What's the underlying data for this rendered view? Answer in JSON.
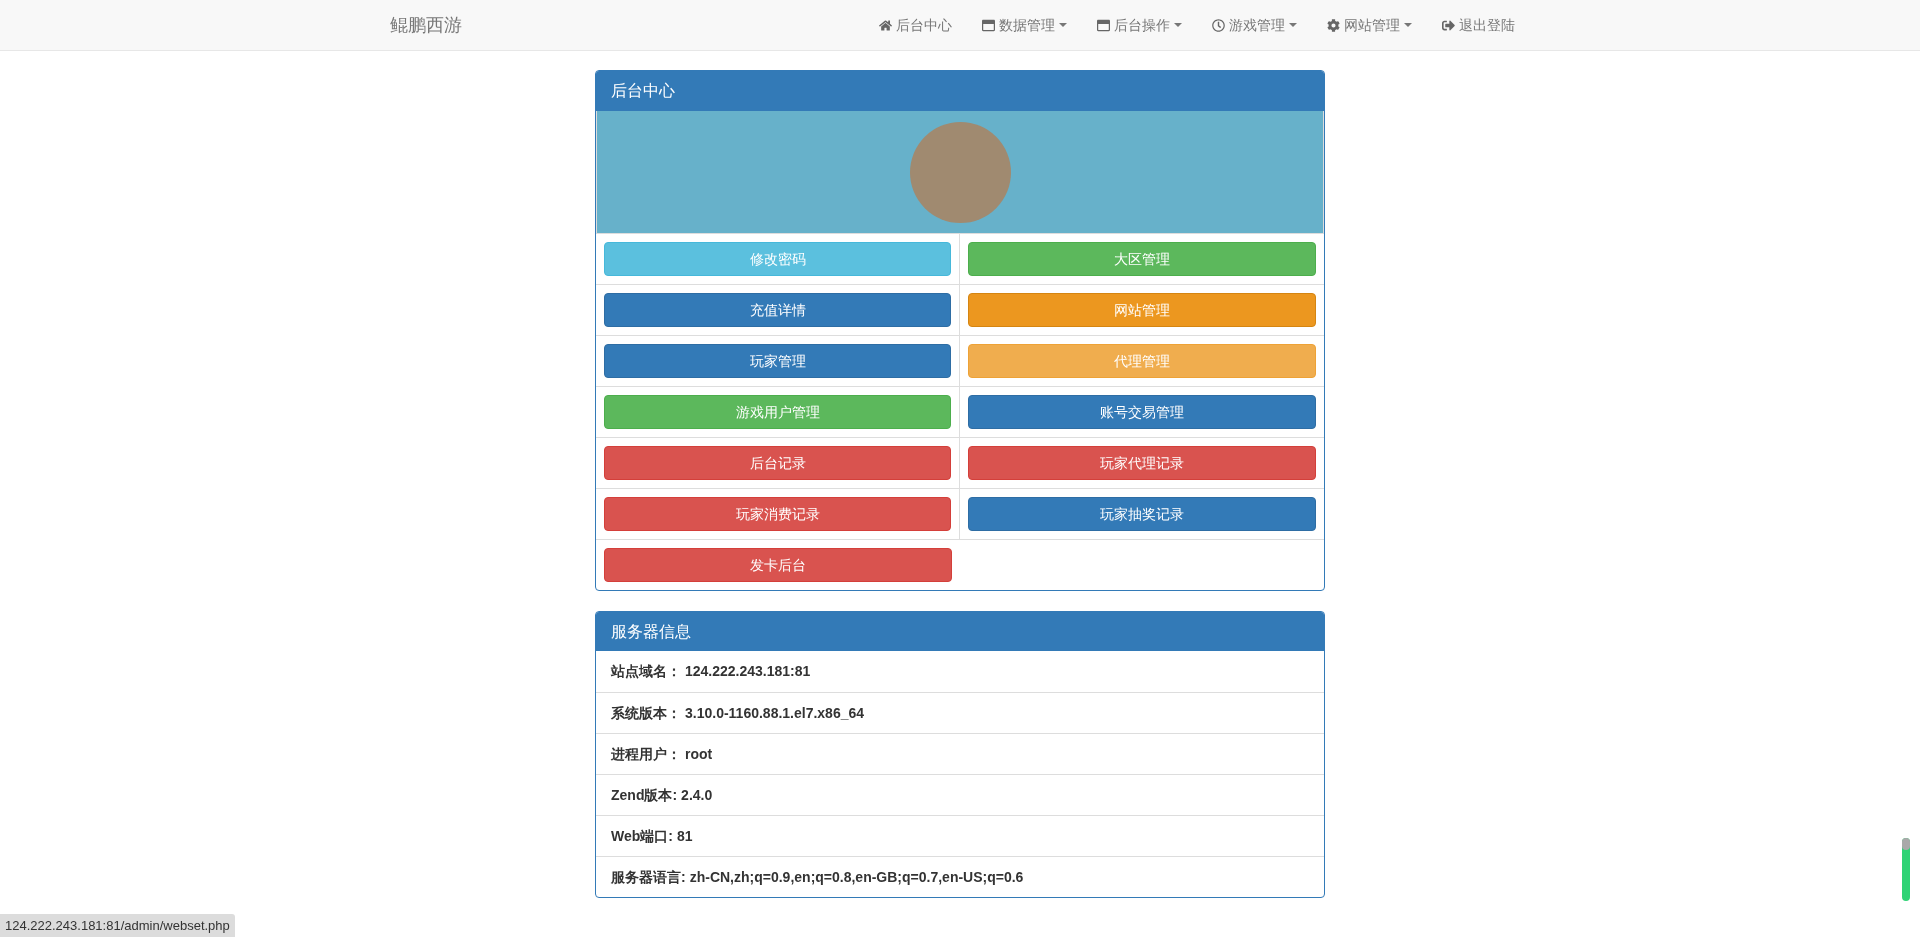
{
  "navbar": {
    "brand": "鲲鹏西游",
    "items": [
      {
        "label": "后台中心",
        "dropdown": false
      },
      {
        "label": "数据管理",
        "dropdown": true
      },
      {
        "label": "后台操作",
        "dropdown": true
      },
      {
        "label": "游戏管理",
        "dropdown": true
      },
      {
        "label": "网站管理",
        "dropdown": true
      },
      {
        "label": "退出登陆",
        "dropdown": false
      }
    ]
  },
  "admin_panel": {
    "title": "后台中心",
    "buttons": [
      {
        "label": "修改密码",
        "kind": "info"
      },
      {
        "label": "大区管理",
        "kind": "success"
      },
      {
        "label": "充值详情",
        "kind": "primary"
      },
      {
        "label": "网站管理",
        "kind": "orange"
      },
      {
        "label": "玩家管理",
        "kind": "primary"
      },
      {
        "label": "代理管理",
        "kind": "warning"
      },
      {
        "label": "游戏用户管理",
        "kind": "success"
      },
      {
        "label": "账号交易管理",
        "kind": "primary"
      },
      {
        "label": "后台记录",
        "kind": "danger"
      },
      {
        "label": "玩家代理记录",
        "kind": "danger"
      },
      {
        "label": "玩家消费记录",
        "kind": "danger"
      },
      {
        "label": "玩家抽奖记录",
        "kind": "primary"
      },
      {
        "label": "发卡后台",
        "kind": "danger"
      }
    ]
  },
  "server_panel": {
    "title": "服务器信息",
    "rows": [
      {
        "label": "站点域名：",
        "value": "124.222.243.181:81"
      },
      {
        "label": "系统版本：",
        "value": "3.10.0-1160.88.1.el7.x86_64"
      },
      {
        "label": "进程用户：",
        "value": "root"
      },
      {
        "label": "Zend版本:",
        "value": "2.4.0"
      },
      {
        "label": "Web端口:",
        "value": "81"
      },
      {
        "label": "服务器语言:",
        "value": "zh-CN,zh;q=0.9,en;q=0.8,en-GB;q=0.7,en-US;q=0.6"
      }
    ]
  },
  "status_bar": {
    "url": "124.222.243.181:81/admin/webset.php"
  }
}
